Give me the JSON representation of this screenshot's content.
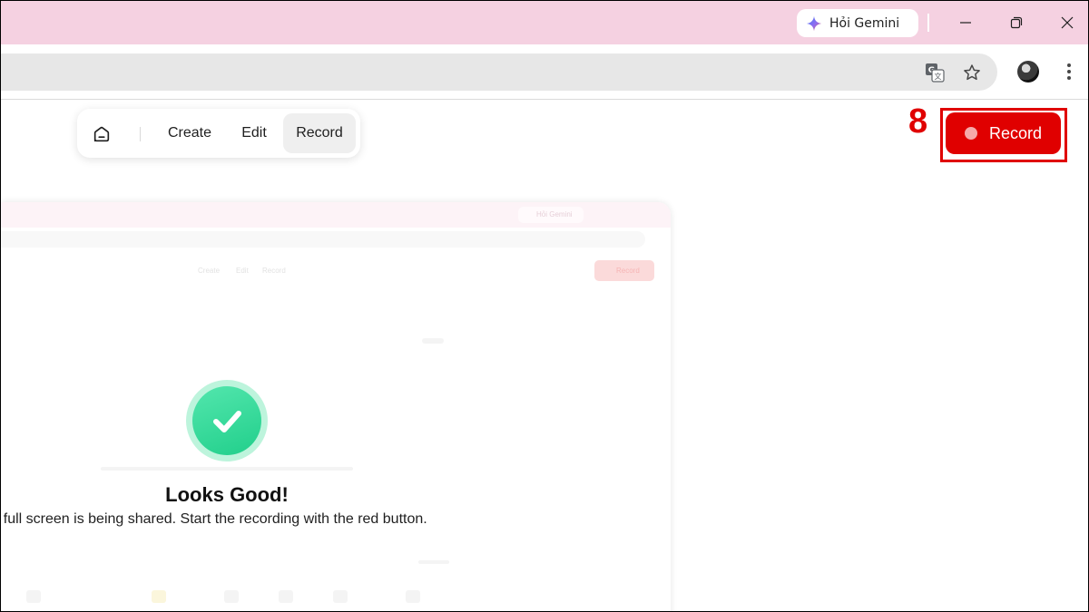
{
  "browser": {
    "gemini_button_label": "Hỏi Gemini",
    "window_controls": [
      "minimize-icon",
      "restore-icon",
      "close-icon"
    ],
    "toolbar_icons": [
      "google-translate-icon",
      "bookmark-star-icon",
      "profile-avatar",
      "more-menu-icon"
    ]
  },
  "nav": {
    "home_icon": "home-icon",
    "items": [
      {
        "label": "Create",
        "active": false
      },
      {
        "label": "Edit",
        "active": false
      },
      {
        "label": "Record",
        "active": true
      }
    ]
  },
  "annotation": {
    "step_number": "8"
  },
  "record_button": {
    "label": "Record",
    "color": "#e00000"
  },
  "preview": {
    "gemini_label": "Hỏi Gemini",
    "nav_items": [
      "Create",
      "Edit",
      "Record"
    ],
    "record_label": "Record"
  },
  "status": {
    "icon": "check-icon",
    "title": "Looks Good!",
    "description": "r full screen is being shared. Start the recording with the red button."
  }
}
